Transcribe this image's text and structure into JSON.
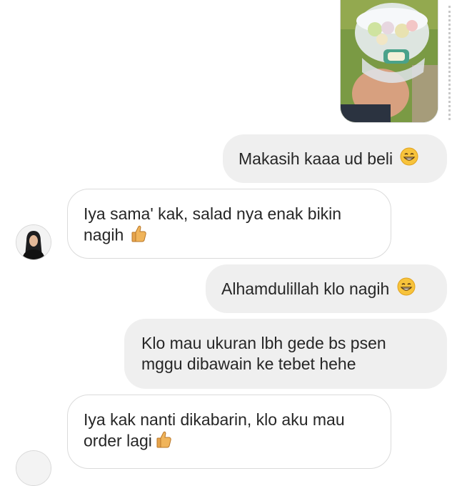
{
  "messages": [
    {
      "side": "out",
      "text": "Makasih kaaa ud beli",
      "emoji": "grinning-face-icon"
    },
    {
      "side": "in",
      "line1": "Iya sama' kak, salad nya enak bikin",
      "line2": "nagih",
      "emoji": "thumbs-up-icon"
    },
    {
      "side": "out",
      "text": "Alhamdulillah klo nagih",
      "emoji": "grinning-face-icon"
    },
    {
      "side": "out",
      "line1": "Klo mau ukuran lbh gede bs psen",
      "line2": "mggu dibawain ke tebet hehe"
    },
    {
      "side": "in",
      "line1": "Iya kak nanti dikabarin, klo aku mau",
      "line2": "order lagi",
      "emoji": "thumbs-up-icon"
    }
  ],
  "colors": {
    "outgoing_bubble": "#efefef",
    "incoming_border": "#dbdbdb",
    "text": "#262626"
  }
}
